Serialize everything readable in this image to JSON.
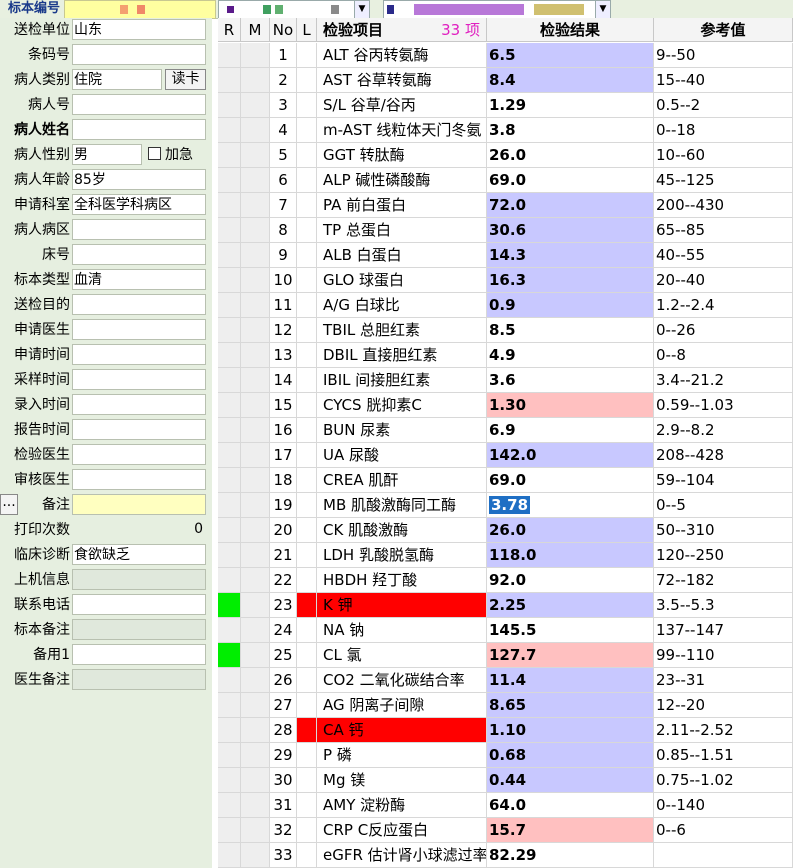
{
  "topbar": {
    "label": "标本编号"
  },
  "patient_form": [
    {
      "key": "送检单位",
      "value": "山东",
      "style": "white"
    },
    {
      "key": "条码号",
      "value": "",
      "style": "white"
    },
    {
      "key": "病人类别",
      "value": "住院",
      "style": "white",
      "button": "读卡"
    },
    {
      "key": "病人号",
      "value": "",
      "style": "white"
    },
    {
      "key": "病人姓名",
      "value": "",
      "style": "white",
      "bold": true
    },
    {
      "key": "病人性别",
      "value": "男",
      "style": "white",
      "checkbox": "加急"
    },
    {
      "key": "病人年龄",
      "value": "85岁",
      "style": "white"
    },
    {
      "key": "申请科室",
      "value": "全科医学科病区",
      "style": "white"
    },
    {
      "key": "病人病区",
      "value": "",
      "style": "white"
    },
    {
      "key": "床号",
      "value": "",
      "style": "white"
    },
    {
      "key": "标本类型",
      "value": "血清",
      "style": "white"
    },
    {
      "key": "送检目的",
      "value": "",
      "style": "white"
    },
    {
      "key": "申请医生",
      "value": "",
      "style": "white"
    },
    {
      "key": "申请时间",
      "value": "",
      "style": "white"
    },
    {
      "key": "采样时间",
      "value": "",
      "style": "white"
    },
    {
      "key": "录入时间",
      "value": "",
      "style": "white"
    },
    {
      "key": "报告时间",
      "value": "",
      "style": "white"
    },
    {
      "key": "检验医生",
      "value": "",
      "style": "white"
    },
    {
      "key": "审核医生",
      "value": "",
      "style": "white"
    },
    {
      "key": "备注",
      "value": "",
      "style": "yellow",
      "prefix_button": "..."
    },
    {
      "key": "打印次数",
      "value": "0",
      "style": "num"
    },
    {
      "key": "临床诊断",
      "value": "食欲缺乏",
      "style": "white"
    },
    {
      "key": "上机信息",
      "value": "",
      "style": "grey"
    },
    {
      "key": "联系电话",
      "value": "",
      "style": "white"
    },
    {
      "key": "标本备注",
      "value": "",
      "style": "grey"
    },
    {
      "key": "备用1",
      "value": "",
      "style": "white"
    },
    {
      "key": "医生备注",
      "value": "",
      "style": "grey"
    }
  ],
  "grid": {
    "headers": {
      "r": "R",
      "m": "M",
      "no": "No",
      "l": "L",
      "item": "检验项目",
      "count": "33 项",
      "result": "检验结果",
      "ref": "参考值"
    },
    "colors": {
      "low": "#c8c8ff",
      "high": "#ffc0c0",
      "critical": "#ff0000",
      "flag_green": "#00ee00",
      "selected": "#1f6fc4"
    },
    "rows": [
      {
        "no": "1",
        "item": "ALT 谷丙转氨酶",
        "result": "6.5",
        "ref": "9--50",
        "flag": "low"
      },
      {
        "no": "2",
        "item": "AST 谷草转氨酶",
        "result": "8.4",
        "ref": "15--40",
        "flag": "low"
      },
      {
        "no": "3",
        "item": "S/L 谷草/谷丙",
        "result": "1.29",
        "ref": "0.5--2",
        "flag": ""
      },
      {
        "no": "4",
        "item": "m-AST 线粒体天门冬氨",
        "result": "3.8",
        "ref": "0--18",
        "flag": ""
      },
      {
        "no": "5",
        "item": "GGT 转肽酶",
        "result": "26.0",
        "ref": "10--60",
        "flag": ""
      },
      {
        "no": "6",
        "item": "ALP 碱性磷酸酶",
        "result": "69.0",
        "ref": "45--125",
        "flag": ""
      },
      {
        "no": "7",
        "item": "PA 前白蛋白",
        "result": "72.0",
        "ref": "200--430",
        "flag": "low"
      },
      {
        "no": "8",
        "item": "TP 总蛋白",
        "result": "30.6",
        "ref": "65--85",
        "flag": "low"
      },
      {
        "no": "9",
        "item": "ALB 白蛋白",
        "result": "14.3",
        "ref": "40--55",
        "flag": "low"
      },
      {
        "no": "10",
        "item": "GLO 球蛋白",
        "result": "16.3",
        "ref": "20--40",
        "flag": "low"
      },
      {
        "no": "11",
        "item": "A/G 白球比",
        "result": "0.9",
        "ref": "1.2--2.4",
        "flag": "low"
      },
      {
        "no": "12",
        "item": "TBIL 总胆红素",
        "result": "8.5",
        "ref": "0--26",
        "flag": ""
      },
      {
        "no": "13",
        "item": "DBIL 直接胆红素",
        "result": "4.9",
        "ref": "0--8",
        "flag": ""
      },
      {
        "no": "14",
        "item": "IBIL 间接胆红素",
        "result": "3.6",
        "ref": "3.4--21.2",
        "flag": ""
      },
      {
        "no": "15",
        "item": "CYCS 胱抑素C",
        "result": "1.30",
        "ref": "0.59--1.03",
        "flag": "high"
      },
      {
        "no": "16",
        "item": "BUN 尿素",
        "result": "6.9",
        "ref": "2.9--8.2",
        "flag": ""
      },
      {
        "no": "17",
        "item": "UA 尿酸",
        "result": "142.0",
        "ref": "208--428",
        "flag": "low"
      },
      {
        "no": "18",
        "item": "CREA 肌酐",
        "result": "69.0",
        "ref": "59--104",
        "flag": ""
      },
      {
        "no": "19",
        "item": "MB 肌酸激酶同工酶",
        "result": "3.78",
        "ref": "0--5",
        "flag": "selected"
      },
      {
        "no": "20",
        "item": "CK 肌酸激酶",
        "result": "26.0",
        "ref": "50--310",
        "flag": "low"
      },
      {
        "no": "21",
        "item": "LDH 乳酸脱氢酶",
        "result": "118.0",
        "ref": "120--250",
        "flag": "low"
      },
      {
        "no": "22",
        "item": "HBDH 羟丁酸",
        "result": "92.0",
        "ref": "72--182",
        "flag": ""
      },
      {
        "no": "23",
        "item": "K 钾",
        "result": "2.25",
        "ref": "3.5--5.3",
        "flag": "low",
        "critical": true,
        "r_flag": true
      },
      {
        "no": "24",
        "item": "NA 钠",
        "result": "145.5",
        "ref": "137--147",
        "flag": ""
      },
      {
        "no": "25",
        "item": "CL 氯",
        "result": "127.7",
        "ref": "99--110",
        "flag": "high",
        "r_flag": true
      },
      {
        "no": "26",
        "item": "CO2 二氧化碳结合率",
        "result": "11.4",
        "ref": "23--31",
        "flag": "low"
      },
      {
        "no": "27",
        "item": "AG 阴离子间隙",
        "result": "8.65",
        "ref": "12--20",
        "flag": "low"
      },
      {
        "no": "28",
        "item": "CA 钙",
        "result": "1.10",
        "ref": "2.11--2.52",
        "flag": "low",
        "critical": true
      },
      {
        "no": "29",
        "item": "P 磷",
        "result": "0.68",
        "ref": "0.85--1.51",
        "flag": "low"
      },
      {
        "no": "30",
        "item": "Mg 镁",
        "result": "0.44",
        "ref": "0.75--1.02",
        "flag": "low"
      },
      {
        "no": "31",
        "item": "AMY 淀粉酶",
        "result": "64.0",
        "ref": "0--140",
        "flag": ""
      },
      {
        "no": "32",
        "item": "CRP C反应蛋白",
        "result": "15.7",
        "ref": "0--6",
        "flag": "high"
      },
      {
        "no": "33",
        "item": "eGFR 估计肾小球滤过率",
        "result": "82.29",
        "ref": "",
        "flag": ""
      }
    ]
  }
}
